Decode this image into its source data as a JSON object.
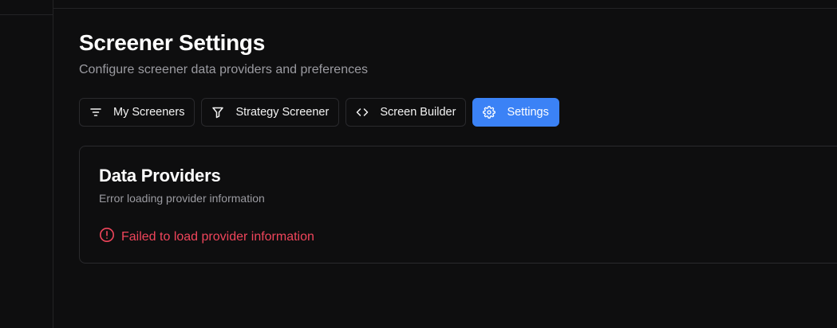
{
  "header": {
    "title": "Screener Settings",
    "subtitle": "Configure screener data providers and preferences"
  },
  "tabs": [
    {
      "label": "My Screeners",
      "icon": "filter-lines-icon",
      "active": false
    },
    {
      "label": "Strategy Screener",
      "icon": "funnel-icon",
      "active": false
    },
    {
      "label": "Screen Builder",
      "icon": "code-icon",
      "active": false
    },
    {
      "label": "Settings",
      "icon": "gear-icon",
      "active": true
    }
  ],
  "card": {
    "title": "Data Providers",
    "description": "Error loading provider information",
    "error_message": "Failed to load provider information"
  },
  "colors": {
    "background": "#0e0e0f",
    "accent": "#3b82f6",
    "error": "#f0455b",
    "muted_text": "#9b9ba1",
    "border": "#2a2a2d"
  }
}
